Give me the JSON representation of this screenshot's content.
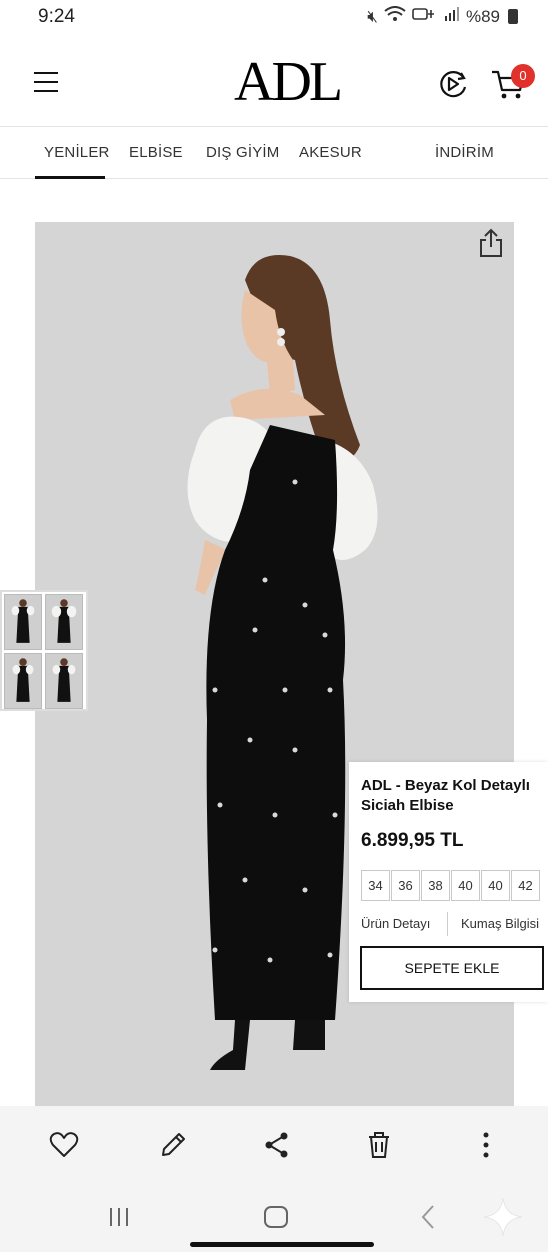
{
  "status_bar": {
    "time": "9:24",
    "battery_text": "%89",
    "icons": [
      "mute-icon",
      "wifi-icon",
      "lte-icon",
      "signal-icon",
      "battery-icon"
    ]
  },
  "header": {
    "logo_text": "ADL",
    "cart_count": "0",
    "icons": [
      "menu-icon",
      "video-play-icon",
      "cart-icon"
    ]
  },
  "nav": {
    "items": [
      {
        "label": "YENİLER",
        "active": true
      },
      {
        "label": "ELBİSE",
        "active": false
      },
      {
        "label": "DIŞ GİYİM",
        "active": false
      },
      {
        "label": "AKESUR",
        "active": false
      },
      {
        "label": "İNDİRİM",
        "active": false
      }
    ]
  },
  "product": {
    "title": "ADL - Beyaz Kol Detaylı Siciah Elbise",
    "price": "6.899,95 TL",
    "sizes": [
      "34",
      "36",
      "38",
      "40",
      "40",
      "42"
    ],
    "tabs": {
      "detail": "Ürün Detayı",
      "fabric": "Kumaş Bilgisi"
    },
    "add_to_cart_label": "SEPETE EKLE",
    "thumbnail_count": 4
  },
  "toolbar": {
    "icons": [
      "heart-icon",
      "edit-icon",
      "share-icon",
      "trash-icon",
      "more-icon"
    ]
  },
  "system_nav": {
    "icons": [
      "recent-apps-icon",
      "home-icon",
      "back-icon"
    ]
  },
  "colors": {
    "accent_badge": "#e0322b",
    "image_background": "#d5d5d6",
    "toolbar_background": "#f4f4f4"
  }
}
